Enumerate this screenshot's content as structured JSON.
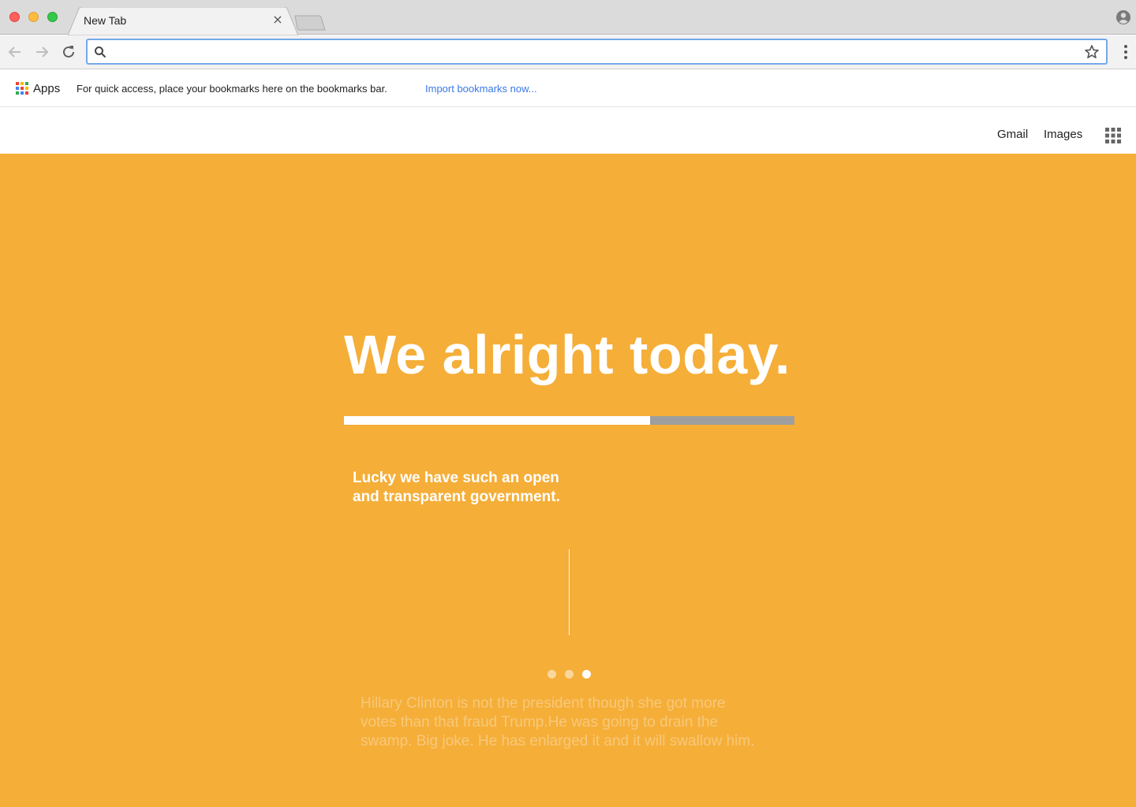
{
  "browser": {
    "tab": {
      "title": "New Tab",
      "close_glyph": "×"
    },
    "omnibox": {
      "value": "",
      "placeholder": ""
    },
    "icons": [
      "back-icon",
      "forward-icon",
      "reload-icon",
      "search-icon",
      "star-icon",
      "menu-icon",
      "profile-icon"
    ]
  },
  "bookmarks_bar": {
    "apps_label": "Apps",
    "hint": "For quick access, place your bookmarks here on the bookmarks bar.",
    "import_link": "Import bookmarks now..."
  },
  "google_header": {
    "gmail": "Gmail",
    "images": "Images",
    "apps_icon": "grid-apps-icon"
  },
  "hero": {
    "title": "We alright today.",
    "progress": 0.68,
    "subtitle_line1": "Lucky we have such an open",
    "subtitle_line2": "and transparent government.",
    "body_line1": "Hillary Clinton is not the president though she got more",
    "body_line2": "votes than that fraud Trump.He was going to drain the",
    "body_line3": "swamp. Big joke. He has enlarged it and it will swallow him.",
    "active_dot": 3,
    "dot_count": 3
  },
  "colors": {
    "accent": "#f5ae38",
    "progress_fill": "#ffffff",
    "progress_track": "#9e9e9e",
    "link": "#3b78e7"
  }
}
